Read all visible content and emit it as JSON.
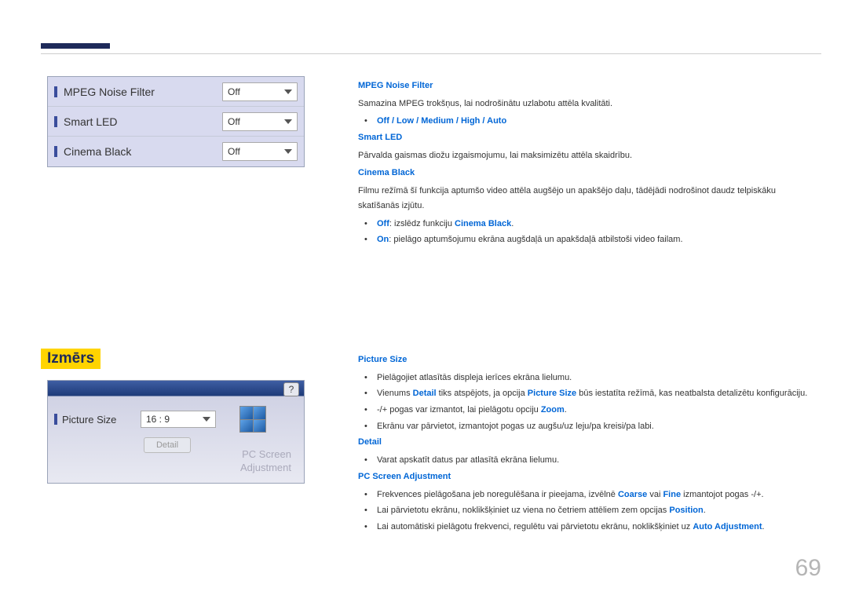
{
  "page_number": "69",
  "panel1": {
    "rows": [
      {
        "label": "MPEG Noise Filter",
        "value": "Off"
      },
      {
        "label": "Smart LED",
        "value": "Off"
      },
      {
        "label": "Cinema Black",
        "value": "Off"
      }
    ]
  },
  "text1": {
    "mpeg_title": "MPEG Noise Filter",
    "mpeg_desc": "Samazina MPEG trokšņus, lai nodrošinātu uzlabotu attēla kvalitāti.",
    "mpeg_options": "Off / Low / Medium / High / Auto",
    "smartled_title": "Smart LED",
    "smartled_desc": "Pārvalda gaismas diožu izgaismojumu, lai maksimizētu attēla skaidrību.",
    "cinema_title": "Cinema Black",
    "cinema_desc": "Filmu režīmā šī funkcija aptumšo video attēla augšējo un apakšējo daļu, tādējādi nodrošinot daudz telpiskāku skatīšanās izjūtu.",
    "cinema_off_label": "Off",
    "cinema_off_text": ": izslēdz funkciju ",
    "cinema_off_ref": "Cinema Black",
    "cinema_off_end": ".",
    "cinema_on_label": "On",
    "cinema_on_text": ": pielāgo aptumšojumu ekrāna augšdaļā un apakšdaļā atbilstoši video failam."
  },
  "section_heading": "Izmērs",
  "panel2": {
    "help": "?",
    "label": "Picture Size",
    "value": "16 : 9",
    "detail_btn": "Detail",
    "disabled1": "PC Screen",
    "disabled2": "Adjustment"
  },
  "text2": {
    "picsize_title": "Picture Size",
    "picsize_b1": "Pielāgojiet atlasītās displeja ierīces ekrāna lielumu.",
    "picsize_b2_pre": "Vienums ",
    "picsize_b2_detail": "Detail",
    "picsize_b2_mid": " tiks atspējots, ja opcija ",
    "picsize_b2_ps": "Picture Size",
    "picsize_b2_post": " būs iestatīta režīmā, kas neatbalsta detalizētu konfigurāciju.",
    "picsize_b3_pre": "-/+ pogas var izmantot, lai pielāgotu opciju ",
    "picsize_b3_zoom": "Zoom",
    "picsize_b3_post": ".",
    "picsize_b4": "Ekrānu var pārvietot, izmantojot pogas uz augšu/uz leju/pa kreisi/pa labi.",
    "detail_title": "Detail",
    "detail_b1": "Varat apskatīt datus par atlasītā ekrāna lielumu.",
    "pcadj_title": "PC Screen Adjustment",
    "pcadj_b1_pre": "Frekvences pielāgošana jeb noregulēšana ir pieejama, izvēlnē ",
    "pcadj_b1_coarse": "Coarse",
    "pcadj_b1_or": " vai ",
    "pcadj_b1_fine": "Fine",
    "pcadj_b1_post": " izmantojot pogas -/+.",
    "pcadj_b2_pre": "Lai pārvietotu ekrānu, noklikšķiniet uz viena no četriem attēliem zem opcijas ",
    "pcadj_b2_pos": "Position",
    "pcadj_b2_post": ".",
    "pcadj_b3_pre": "Lai automātiski pielāgotu frekvenci, regulētu vai pārvietotu ekrānu, noklikšķiniet uz ",
    "pcadj_b3_auto": "Auto Adjustment",
    "pcadj_b3_post": "."
  }
}
